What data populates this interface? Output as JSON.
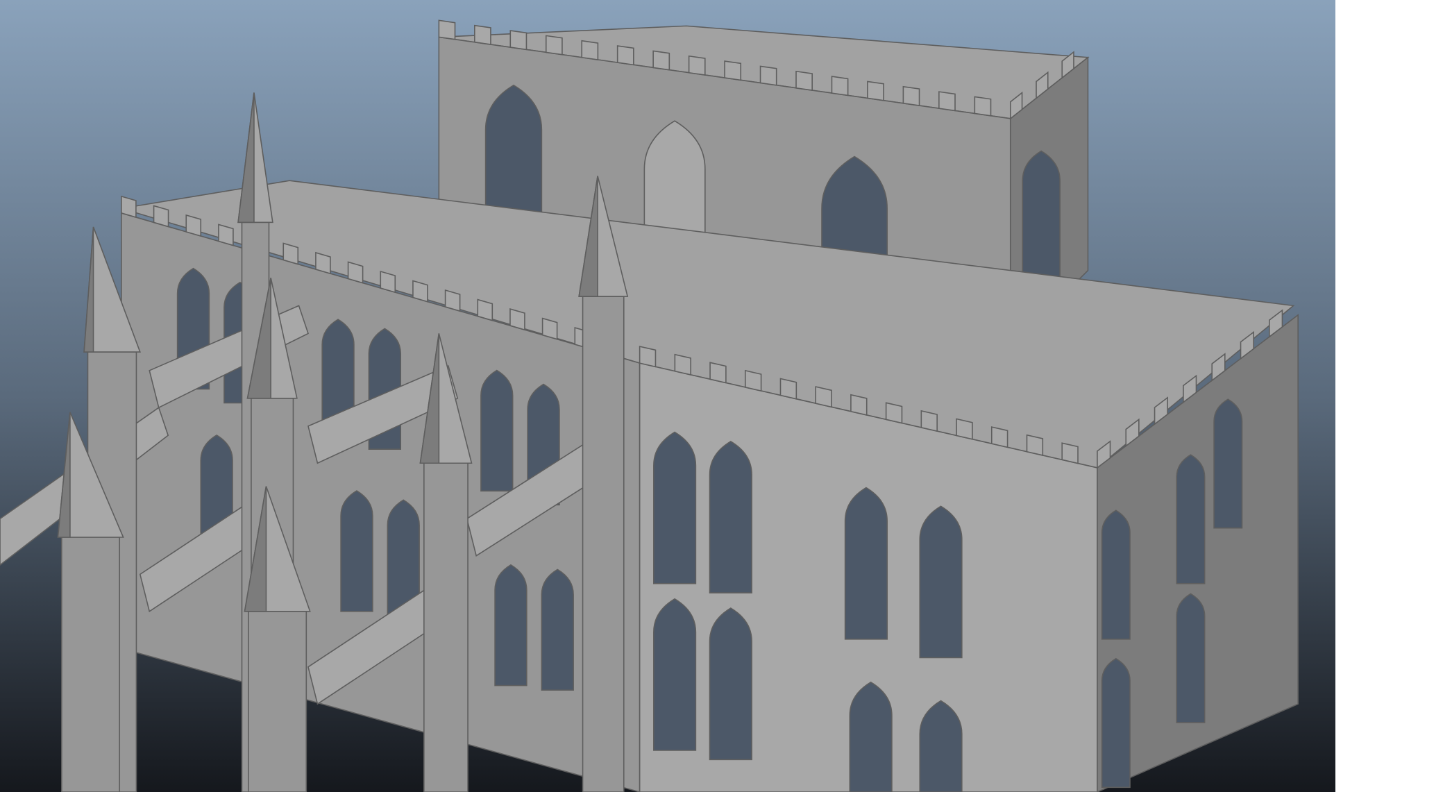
{
  "scene": {
    "subject": "gothic-cathedral-model",
    "colors": {
      "sky_top": "#8aa2bb",
      "sky_mid": "#5a6a7c",
      "sky_bottom": "#15181d",
      "stone_light": "#a8a8a8",
      "stone": "#979797",
      "stone_dark": "#7c7c7c",
      "roof": "#a2a2a2",
      "window": "#4c5868",
      "edge": "#5e5e5e"
    }
  }
}
